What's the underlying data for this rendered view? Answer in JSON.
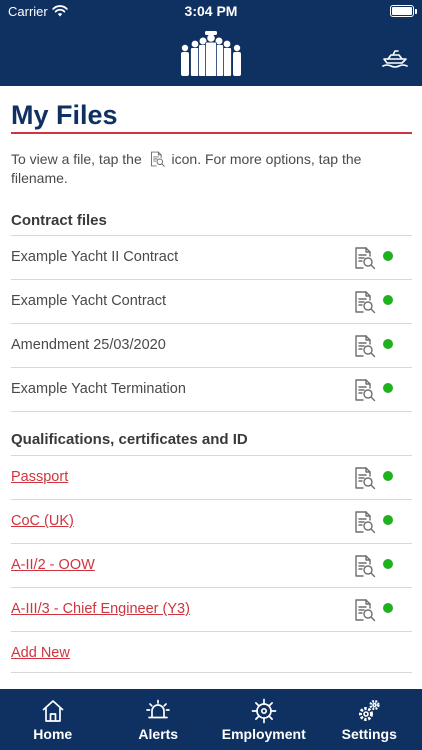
{
  "status_bar": {
    "carrier": "Carrier",
    "time": "3:04 PM"
  },
  "header": {
    "logo_icon": "crew-logo-icon",
    "action_icon": "yacht-icon"
  },
  "page": {
    "title": "My Files",
    "instructions_before": "To view a file, tap the",
    "instructions_after": "icon. For more options, tap the filename."
  },
  "contract_section": {
    "heading": "Contract files",
    "items": [
      {
        "label": "Example Yacht II Contract",
        "status": "uploaded"
      },
      {
        "label": "Example Yacht Contract",
        "status": "uploaded"
      },
      {
        "label": "Amendment 25/03/2020",
        "status": "uploaded"
      },
      {
        "label": "Example Yacht Termination",
        "status": "uploaded"
      }
    ]
  },
  "qualifications_section": {
    "heading": "Qualifications, certificates and ID",
    "items": [
      {
        "label": "Passport",
        "status": "uploaded"
      },
      {
        "label": "CoC (UK)",
        "status": "uploaded"
      },
      {
        "label": "A-II/2 - OOW",
        "status": "uploaded"
      },
      {
        "label": "A-III/3 - Chief Engineer (Y3)",
        "status": "uploaded"
      }
    ],
    "add_new": "Add New"
  },
  "colors": {
    "navy": "#0f3161",
    "accent_red": "#d0343e",
    "status_green": "#1fb11f"
  },
  "tabs": [
    {
      "label": "Home",
      "icon": "home-icon"
    },
    {
      "label": "Alerts",
      "icon": "bell-icon"
    },
    {
      "label": "Employment",
      "icon": "helm-icon"
    },
    {
      "label": "Settings",
      "icon": "gear-icon"
    }
  ]
}
